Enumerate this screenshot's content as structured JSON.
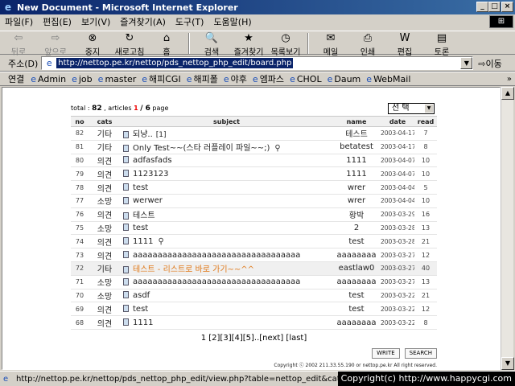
{
  "window": {
    "title": "New Document - Microsoft Internet Explorer"
  },
  "menu": [
    "파일(F)",
    "편집(E)",
    "보기(V)",
    "즐겨찾기(A)",
    "도구(T)",
    "도움말(H)"
  ],
  "toolbar": {
    "back": "뒤로",
    "forward": "앞으로",
    "stop": "중지",
    "refresh": "새로고침",
    "home": "홈",
    "search": "검색",
    "favorites": "즐겨찾기",
    "history": "목록보기",
    "mail": "메일",
    "print": "인쇄",
    "edit": "편집",
    "discuss": "토론"
  },
  "address": {
    "label": "주소(D)",
    "url": "http://nettop.pe.kr/nettop/pds_nettop_php_edit/board.php",
    "go": "이동"
  },
  "links": {
    "label": "연결",
    "items": [
      "Admin",
      "job",
      "master",
      "해피CGI",
      "해피폴",
      "야후",
      "엠파스",
      "CHOL",
      "Daum",
      "WebMail"
    ]
  },
  "board": {
    "total_label": "total :",
    "total": "82",
    "articles_label": ", articles",
    "page_current": "1",
    "page_total": "/ 6",
    "page_label": "page",
    "select_label": "선 택",
    "headers": {
      "no": "no",
      "cats": "cats",
      "subject": "subject",
      "name": "name",
      "date": "date",
      "read": "read"
    },
    "rows": [
      {
        "no": "82",
        "cat": "기타",
        "subject": "되냥..",
        "count": "[1]",
        "name": "테스트",
        "date": "2003-04-17",
        "read": "7"
      },
      {
        "no": "81",
        "cat": "기타",
        "subject": "Only Test~~(스타 러플레이 파일~~;)",
        "name": "betatest",
        "date": "2003-04-17",
        "read": "8",
        "clip": true
      },
      {
        "no": "80",
        "cat": "의견",
        "subject": "adfasfads",
        "name": "1111",
        "date": "2003-04-07",
        "read": "10"
      },
      {
        "no": "79",
        "cat": "의견",
        "subject": "1123123",
        "name": "1111",
        "date": "2003-04-07",
        "read": "10"
      },
      {
        "no": "78",
        "cat": "의견",
        "subject": "test",
        "name": "wrer",
        "date": "2003-04-04",
        "read": "5"
      },
      {
        "no": "77",
        "cat": "소망",
        "subject": "werwer",
        "name": "wrer",
        "date": "2003-04-04",
        "read": "10"
      },
      {
        "no": "76",
        "cat": "의견",
        "subject": "테스트",
        "name": "황박",
        "date": "2003-03-29",
        "read": "16"
      },
      {
        "no": "75",
        "cat": "소망",
        "subject": "test",
        "name": "2",
        "date": "2003-03-28",
        "read": "13"
      },
      {
        "no": "74",
        "cat": "의견",
        "subject": "1111",
        "name": "test",
        "date": "2003-03-28",
        "read": "21",
        "clip": true
      },
      {
        "no": "73",
        "cat": "의견",
        "subject": "aaaaaaaaaaaaaaaaaaaaaaaaaaaaaaaaaa",
        "name": "aaaaaaaa",
        "date": "2003-03-27",
        "read": "12"
      },
      {
        "no": "72",
        "cat": "기타",
        "subject": "테스트 - 리스트로 바로 가기~~^^",
        "name": "eastlaw0",
        "date": "2003-03-27",
        "read": "40",
        "highlight": true
      },
      {
        "no": "71",
        "cat": "소망",
        "subject": "aaaaaaaaaaaaaaaaaaaaaaaaaaaaaaaaaa",
        "name": "aaaaaaaa",
        "date": "2003-03-27",
        "read": "13"
      },
      {
        "no": "70",
        "cat": "소망",
        "subject": "asdf",
        "name": "test",
        "date": "2003-03-22",
        "read": "21"
      },
      {
        "no": "69",
        "cat": "의견",
        "subject": "test",
        "name": "test",
        "date": "2003-03-22",
        "read": "12"
      },
      {
        "no": "68",
        "cat": "의견",
        "subject": "1111",
        "name": "aaaaaaaa",
        "date": "2003-03-22",
        "read": "8"
      }
    ],
    "pager": "1 [2][3][4][5]..[next] [last]",
    "write_label": "WRITE",
    "search_label": "SEARCH",
    "copyright": "Copyright ⓒ 2002 211.33.55.190 or nettop.pe.kr All right reserved."
  },
  "status": {
    "text": "http://nettop.pe.kr/nettop/pds_nettop_php_edit/view.php?table=nettop_edit&cats=noting&boa"
  },
  "watermark": "Copyright(c) http://www.happycgi.com"
}
